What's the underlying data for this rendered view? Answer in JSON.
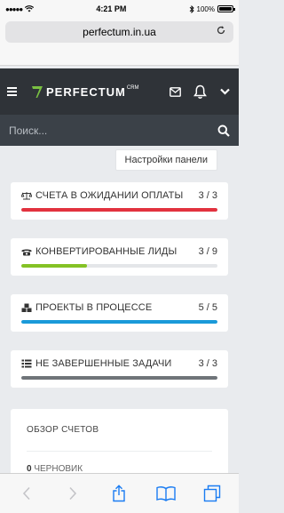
{
  "status_bar": {
    "time": "4:21 PM",
    "battery": "100%",
    "signal": "●●●●●",
    "battery_level": 1.0
  },
  "browser": {
    "url": "perfectum.in.ua"
  },
  "app": {
    "brand": "PERFECTUM",
    "brand_suffix": "CRM"
  },
  "search": {
    "placeholder": "Поиск..."
  },
  "panel_settings_label": "Настройки панели",
  "cards": [
    {
      "icon": "scales-icon",
      "title": "СЧЕТА В ОЖИДАНИИ ОПЛАТЫ",
      "count": "3 / 3",
      "progress": 1.0,
      "color": "#e2323f"
    },
    {
      "icon": "phone-icon",
      "title": "КОНВЕРТИРОВАННЫЕ ЛИДЫ",
      "count": "3 / 9",
      "progress": 0.3333,
      "color": "#84c225"
    },
    {
      "icon": "cubes-icon",
      "title": "ПРОЕКТЫ В ПРОЦЕССЕ",
      "count": "5 / 5",
      "progress": 1.0,
      "color": "#1a9ad9"
    },
    {
      "icon": "list-icon",
      "title": "НЕ ЗАВЕРШЕННЫЕ ЗАДАЧИ",
      "count": "3 / 3",
      "progress": 1.0,
      "color": "#6f7479"
    }
  ],
  "overview": {
    "title": "ОБЗОР СЧЕТОВ",
    "draft_count": "0",
    "draft_label": "ЧЕРНОВИК"
  },
  "colors": {
    "header_bg": "#2f3338",
    "search_bg": "#3b4148",
    "logo_green": "#7ac142"
  }
}
